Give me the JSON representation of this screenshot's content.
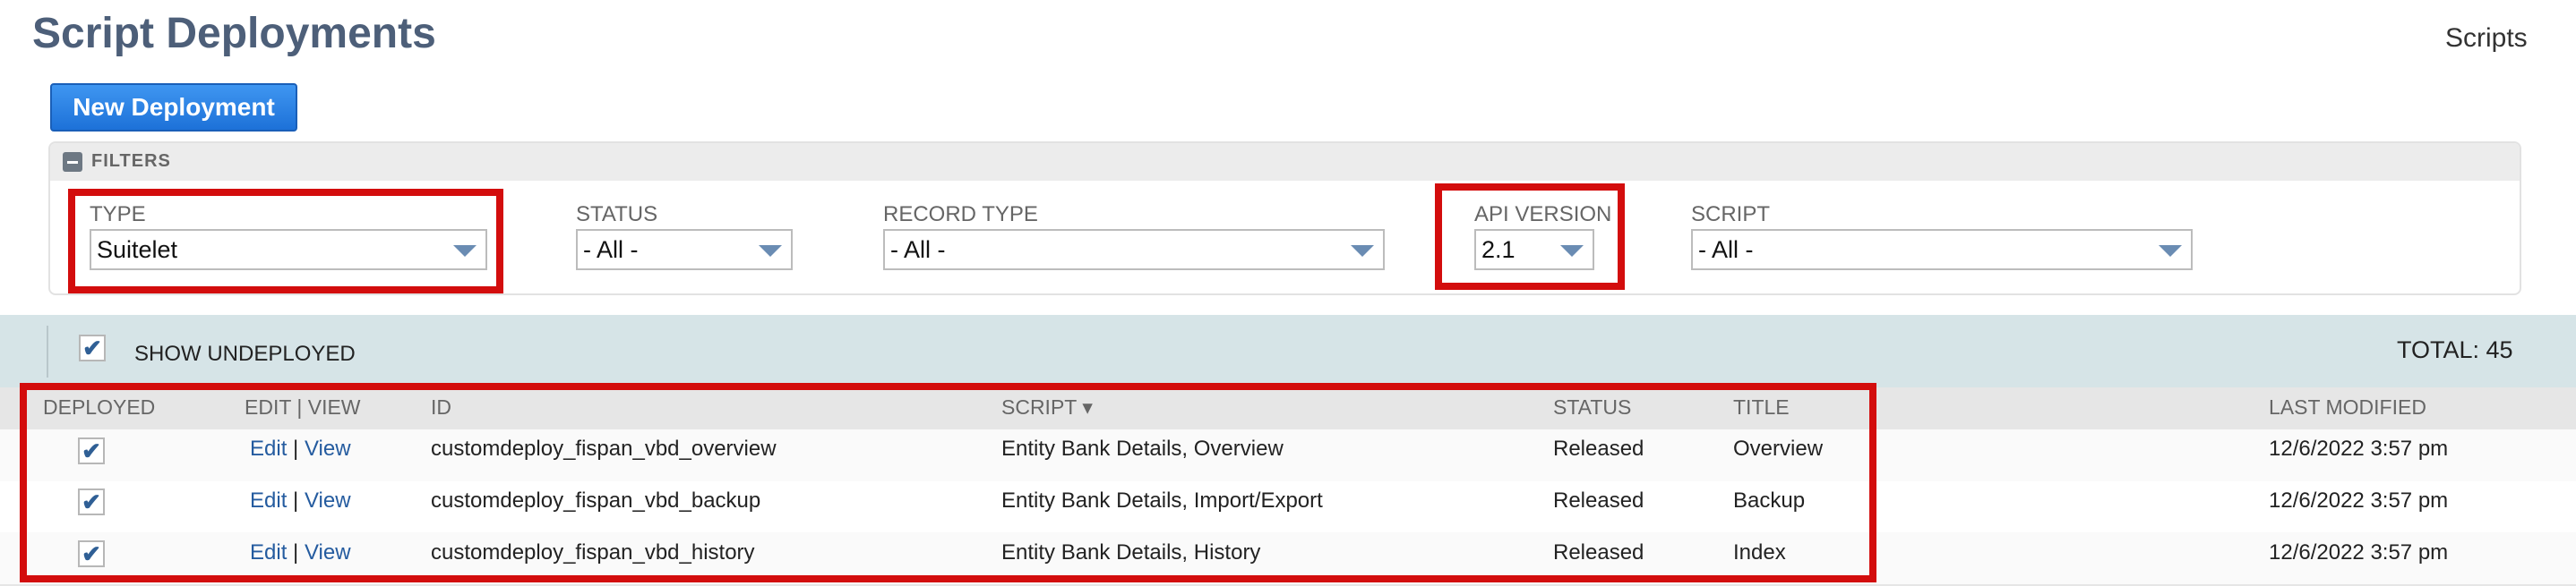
{
  "page": {
    "title": "Script Deployments",
    "scripts_link": "Scripts"
  },
  "toolbar": {
    "new_label": "New Deployment"
  },
  "filters": {
    "header": "FILTERS",
    "type": {
      "label": "TYPE",
      "value": "Suitelet"
    },
    "status": {
      "label": "STATUS",
      "value": "- All -"
    },
    "record_type": {
      "label": "RECORD TYPE",
      "value": "- All -"
    },
    "api_version": {
      "label": "API VERSION",
      "value": "2.1"
    },
    "script": {
      "label": "SCRIPT",
      "value": "- All -"
    }
  },
  "list": {
    "show_undeployed_label": "SHOW UNDEPLOYED",
    "show_undeployed_checked": true,
    "total": "TOTAL: 45",
    "columns": {
      "deployed": "DEPLOYED",
      "edit_view": "EDIT | VIEW",
      "id": "ID",
      "script": "SCRIPT ▾",
      "status": "STATUS",
      "title": "TITLE",
      "last_modified": "LAST MODIFIED"
    },
    "rows": [
      {
        "deployed": true,
        "edit": "Edit",
        "sep": "|",
        "view": "View",
        "id": "customdeploy_fispan_vbd_overview",
        "script": "Entity Bank Details, Overview",
        "status": "Released",
        "title": "Overview",
        "last_modified": "12/6/2022 3:57 pm"
      },
      {
        "deployed": true,
        "edit": "Edit",
        "sep": "|",
        "view": "View",
        "id": "customdeploy_fispan_vbd_backup",
        "script": "Entity Bank Details, Import/Export",
        "status": "Released",
        "title": "Backup",
        "last_modified": "12/6/2022 3:57 pm"
      },
      {
        "deployed": true,
        "edit": "Edit",
        "sep": "|",
        "view": "View",
        "id": "customdeploy_fispan_vbd_history",
        "script": "Entity Bank Details, History",
        "status": "Released",
        "title": "Index",
        "last_modified": "12/6/2022 3:57 pm"
      }
    ]
  },
  "colors": {
    "title": "#4d5f79",
    "button": "#2a7ee3",
    "highlight": "#d30d0d",
    "band": "#d6e4e7",
    "link": "#245b9f"
  }
}
